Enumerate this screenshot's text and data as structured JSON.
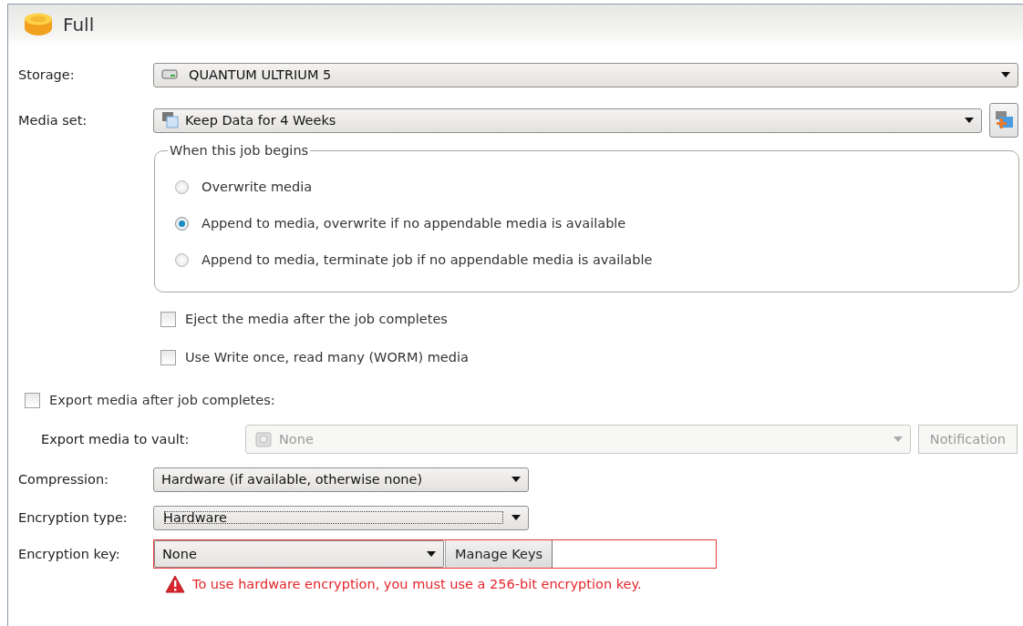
{
  "header": {
    "title": "Full"
  },
  "storage": {
    "label": "Storage:",
    "value": "QUANTUM ULTRIUM 5"
  },
  "media_set": {
    "label": "Media set:",
    "value": "Keep Data for 4 Weeks"
  },
  "job_begins": {
    "legend": "When this job begins",
    "options": [
      {
        "label": "Overwrite media",
        "selected": false
      },
      {
        "label": "Append to media, overwrite if no appendable media is available",
        "selected": true
      },
      {
        "label": "Append to media, terminate job if no appendable media is available",
        "selected": false
      }
    ]
  },
  "media_options": [
    {
      "label": "Eject the media after the job completes",
      "checked": false
    },
    {
      "label": "Use Write once, read many (WORM) media",
      "checked": false
    }
  ],
  "export": {
    "label": "Export media after job completes:",
    "checked": false
  },
  "vault": {
    "label": "Export media to vault:",
    "value": "None",
    "disabled": true,
    "button": "Notification"
  },
  "compression": {
    "label": "Compression:",
    "value": "Hardware (if available, otherwise none)"
  },
  "encryption_type": {
    "label": "Encryption type:",
    "value": "Hardware",
    "focused": true
  },
  "encryption_key": {
    "label": "Encryption key:",
    "value": "None",
    "button": "Manage Keys",
    "invalid": true
  },
  "warning": "To use hardware encryption, you must use a 256-bit encryption key."
}
